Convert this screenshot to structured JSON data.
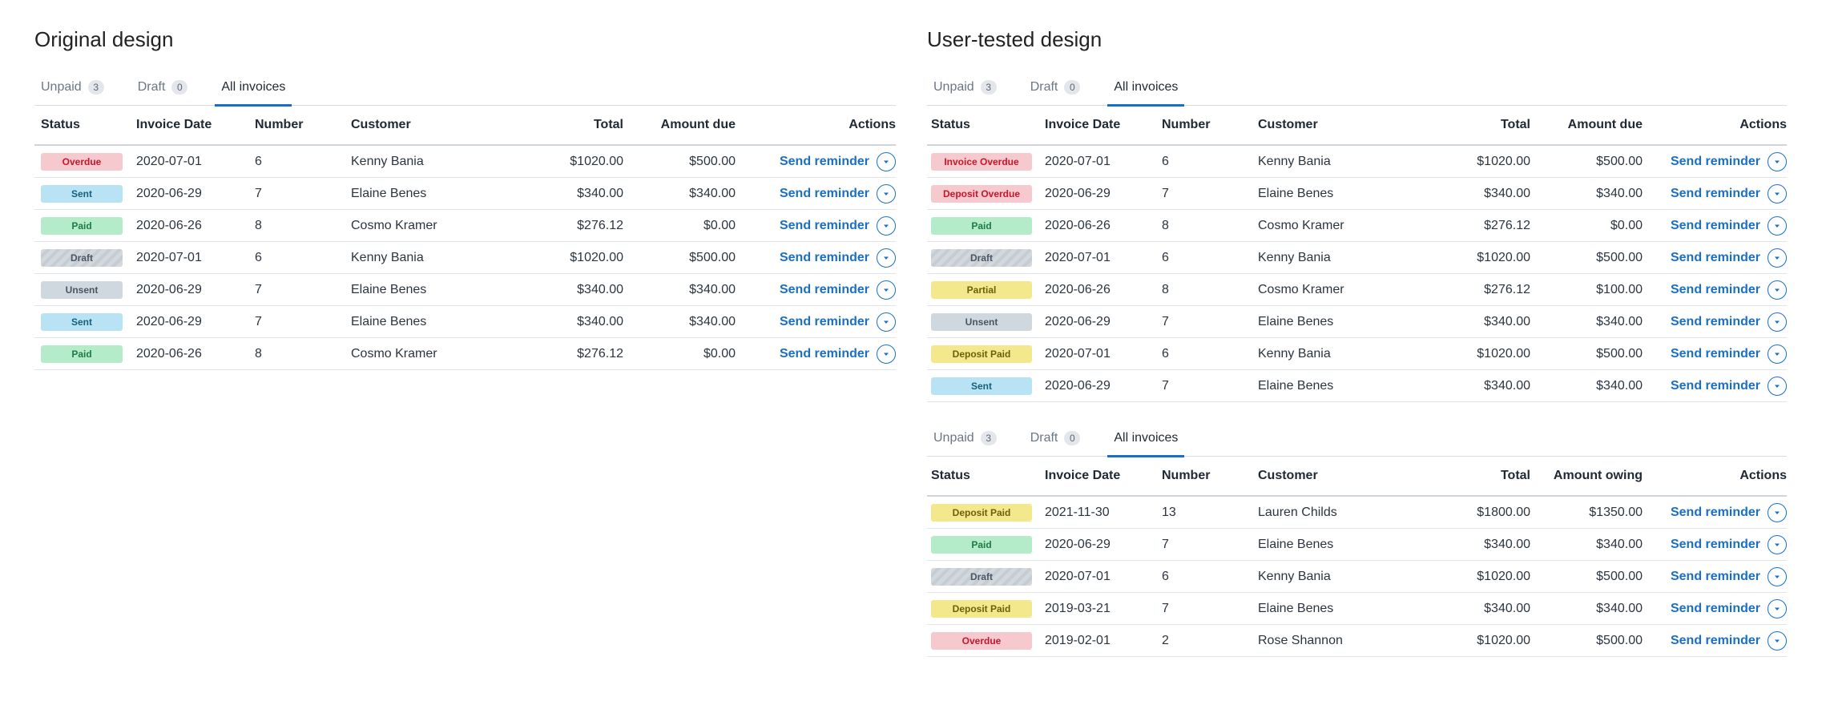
{
  "colors": {
    "accent": "#1a6fc4",
    "overdue": "#f6c9cf",
    "sent": "#b7e3f4",
    "paid": "#b4ebc9",
    "partial": "#f4e88c",
    "unsent": "#cfd7df"
  },
  "left": {
    "title": "Original design",
    "tabs": [
      {
        "label": "Unpaid",
        "count": "3"
      },
      {
        "label": "Draft",
        "count": "0"
      },
      {
        "label": "All invoices",
        "count": ""
      }
    ],
    "columns": {
      "status": "Status",
      "date": "Invoice Date",
      "number": "Number",
      "customer": "Customer",
      "total": "Total",
      "due": "Amount due",
      "actions": "Actions"
    },
    "rows": [
      {
        "status": "Overdue",
        "date": "2020-07-01",
        "number": "6",
        "customer": "Kenny Bania",
        "total": "$1020.00",
        "due": "$500.00",
        "action": "Send reminder"
      },
      {
        "status": "Sent",
        "date": "2020-06-29",
        "number": "7",
        "customer": "Elaine Benes",
        "total": "$340.00",
        "due": "$340.00",
        "action": "Send reminder"
      },
      {
        "status": "Paid",
        "date": "2020-06-26",
        "number": "8",
        "customer": "Cosmo Kramer",
        "total": "$276.12",
        "due": "$0.00",
        "action": "Send reminder"
      },
      {
        "status": "Draft",
        "date": "2020-07-01",
        "number": "6",
        "customer": "Kenny Bania",
        "total": "$1020.00",
        "due": "$500.00",
        "action": "Send reminder"
      },
      {
        "status": "Unsent",
        "date": "2020-06-29",
        "number": "7",
        "customer": "Elaine Benes",
        "total": "$340.00",
        "due": "$340.00",
        "action": "Send reminder"
      },
      {
        "status": "Sent",
        "date": "2020-06-29",
        "number": "7",
        "customer": "Elaine Benes",
        "total": "$340.00",
        "due": "$340.00",
        "action": "Send reminder"
      },
      {
        "status": "Paid",
        "date": "2020-06-26",
        "number": "8",
        "customer": "Cosmo Kramer",
        "total": "$276.12",
        "due": "$0.00",
        "action": "Send reminder"
      }
    ]
  },
  "right": {
    "title": "User-tested design",
    "top": {
      "tabs": [
        {
          "label": "Unpaid",
          "count": "3"
        },
        {
          "label": "Draft",
          "count": "0"
        },
        {
          "label": "All invoices",
          "count": ""
        }
      ],
      "columns": {
        "status": "Status",
        "date": "Invoice Date",
        "number": "Number",
        "customer": "Customer",
        "total": "Total",
        "due": "Amount due",
        "actions": "Actions"
      },
      "rows": [
        {
          "status": "Invoice Overdue",
          "date": "2020-07-01",
          "number": "6",
          "customer": "Kenny Bania",
          "total": "$1020.00",
          "due": "$500.00",
          "action": "Send reminder"
        },
        {
          "status": "Deposit Overdue",
          "date": "2020-06-29",
          "number": "7",
          "customer": "Elaine Benes",
          "total": "$340.00",
          "due": "$340.00",
          "action": "Send reminder"
        },
        {
          "status": "Paid",
          "date": "2020-06-26",
          "number": "8",
          "customer": "Cosmo Kramer",
          "total": "$276.12",
          "due": "$0.00",
          "action": "Send reminder"
        },
        {
          "status": "Draft",
          "date": "2020-07-01",
          "number": "6",
          "customer": "Kenny Bania",
          "total": "$1020.00",
          "due": "$500.00",
          "action": "Send reminder"
        },
        {
          "status": "Partial",
          "date": "2020-06-26",
          "number": "8",
          "customer": "Cosmo Kramer",
          "total": "$276.12",
          "due": "$100.00",
          "action": "Send reminder"
        },
        {
          "status": "Unsent",
          "date": "2020-06-29",
          "number": "7",
          "customer": "Elaine Benes",
          "total": "$340.00",
          "due": "$340.00",
          "action": "Send reminder"
        },
        {
          "status": "Deposit Paid",
          "date": "2020-07-01",
          "number": "6",
          "customer": "Kenny Bania",
          "total": "$1020.00",
          "due": "$500.00",
          "action": "Send reminder"
        },
        {
          "status": "Sent",
          "date": "2020-06-29",
          "number": "7",
          "customer": "Elaine Benes",
          "total": "$340.00",
          "due": "$340.00",
          "action": "Send reminder"
        }
      ]
    },
    "bottom": {
      "tabs": [
        {
          "label": "Unpaid",
          "count": "3"
        },
        {
          "label": "Draft",
          "count": "0"
        },
        {
          "label": "All invoices",
          "count": ""
        }
      ],
      "columns": {
        "status": "Status",
        "date": "Invoice Date",
        "number": "Number",
        "customer": "Customer",
        "total": "Total",
        "due": "Amount owing",
        "actions": "Actions"
      },
      "rows": [
        {
          "status": "Deposit Paid",
          "date": "2021-11-30",
          "number": "13",
          "customer": "Lauren Childs",
          "total": "$1800.00",
          "due": "$1350.00",
          "action": "Send reminder"
        },
        {
          "status": "Paid",
          "date": "2020-06-29",
          "number": "7",
          "customer": "Elaine Benes",
          "total": "$340.00",
          "due": "$340.00",
          "action": "Send reminder"
        },
        {
          "status": "Draft",
          "date": "2020-07-01",
          "number": "6",
          "customer": "Kenny Bania",
          "total": "$1020.00",
          "due": "$500.00",
          "action": "Send reminder"
        },
        {
          "status": "Deposit Paid",
          "date": "2019-03-21",
          "number": "7",
          "customer": "Elaine Benes",
          "total": "$340.00",
          "due": "$340.00",
          "action": "Send reminder"
        },
        {
          "status": "Overdue",
          "date": "2019-02-01",
          "number": "2",
          "customer": "Rose Shannon",
          "total": "$1020.00",
          "due": "$500.00",
          "action": "Send reminder"
        }
      ]
    }
  }
}
